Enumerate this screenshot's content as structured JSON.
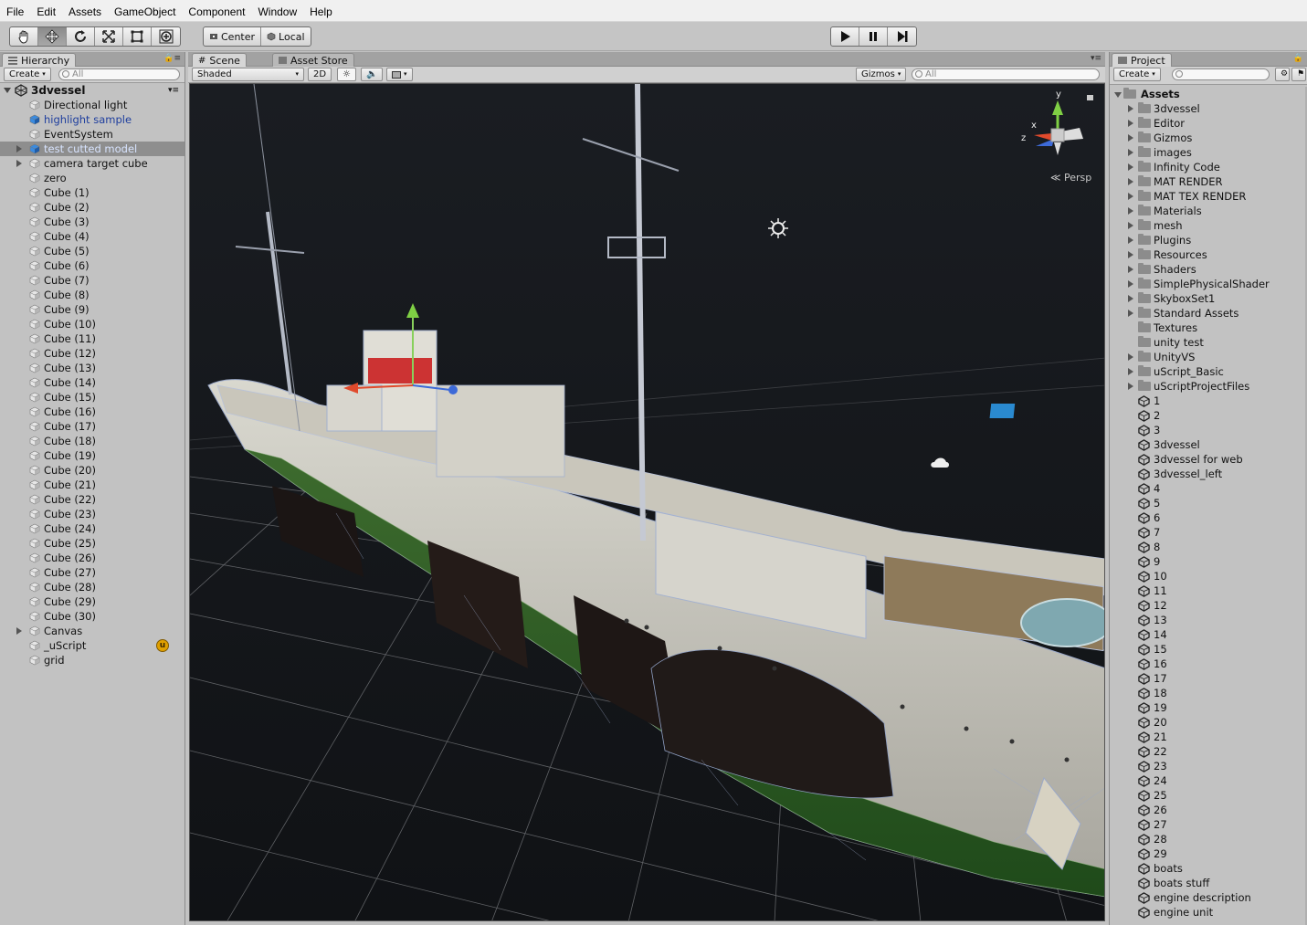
{
  "menu": [
    "File",
    "Edit",
    "Assets",
    "GameObject",
    "Component",
    "Window",
    "Help"
  ],
  "toolbar": {
    "tools": [
      "hand-icon",
      "move-icon",
      "rotate-icon",
      "scale-icon",
      "rect-icon",
      "transform-icon"
    ],
    "pivot_label": "Center",
    "space_label": "Local",
    "playback": [
      "play-icon",
      "pause-icon",
      "step-icon"
    ]
  },
  "hierarchy": {
    "tab": "Hierarchy",
    "create": "Create",
    "search_placeholder": "All",
    "scene_name": "3dvessel",
    "items": [
      {
        "label": "Directional light"
      },
      {
        "label": "highlight sample"
      },
      {
        "label": "EventSystem"
      },
      {
        "label": "test cutted model"
      },
      {
        "label": "camera target cube"
      },
      {
        "label": "zero"
      },
      {
        "label": "Cube (1)"
      },
      {
        "label": "Cube (2)"
      },
      {
        "label": "Cube (3)"
      },
      {
        "label": "Cube (4)"
      },
      {
        "label": "Cube (5)"
      },
      {
        "label": "Cube (6)"
      },
      {
        "label": "Cube (7)"
      },
      {
        "label": "Cube (8)"
      },
      {
        "label": "Cube (9)"
      },
      {
        "label": "Cube (10)"
      },
      {
        "label": "Cube (11)"
      },
      {
        "label": "Cube (12)"
      },
      {
        "label": "Cube (13)"
      },
      {
        "label": "Cube (14)"
      },
      {
        "label": "Cube (15)"
      },
      {
        "label": "Cube (16)"
      },
      {
        "label": "Cube (17)"
      },
      {
        "label": "Cube (18)"
      },
      {
        "label": "Cube (19)"
      },
      {
        "label": "Cube (20)"
      },
      {
        "label": "Cube (21)"
      },
      {
        "label": "Cube (22)"
      },
      {
        "label": "Cube (23)"
      },
      {
        "label": "Cube (24)"
      },
      {
        "label": "Cube (25)"
      },
      {
        "label": "Cube (26)"
      },
      {
        "label": "Cube (27)"
      },
      {
        "label": "Cube (28)"
      },
      {
        "label": "Cube (29)"
      },
      {
        "label": "Cube (30)"
      },
      {
        "label": "Canvas"
      },
      {
        "label": "_uScript"
      },
      {
        "label": "grid"
      }
    ]
  },
  "scene": {
    "tabs": [
      "Scene",
      "Asset Store"
    ],
    "shading": "Shaded",
    "mode_2d": "2D",
    "gizmos": "Gizmos",
    "search_placeholder": "All",
    "persp_label": "Persp",
    "axis_labels": {
      "y": "y",
      "x": "x",
      "z": "z"
    }
  },
  "project": {
    "tab": "Project",
    "create": "Create",
    "root": "Assets",
    "folders": [
      "3dvessel",
      "Editor",
      "Gizmos",
      "images",
      "Infinity Code",
      "MAT RENDER",
      "MAT TEX RENDER",
      "Materials",
      "mesh",
      "Plugins",
      "Resources",
      "Shaders",
      "SimplePhysicalShader",
      "SkyboxSet1",
      "Standard Assets",
      "Textures",
      "unity test",
      "UnityVS",
      "uScript_Basic",
      "uScriptProjectFiles"
    ],
    "scenes": [
      "1",
      "2",
      "3",
      "3dvessel",
      "3dvessel for web",
      "3dvessel_left",
      "4",
      "5",
      "6",
      "7",
      "8",
      "9",
      "10",
      "11",
      "12",
      "13",
      "14",
      "15",
      "16",
      "17",
      "18",
      "19",
      "20",
      "21",
      "22",
      "23",
      "24",
      "25",
      "26",
      "27",
      "28",
      "29",
      "boats",
      "boats stuff",
      "engine description",
      "engine unit"
    ]
  }
}
